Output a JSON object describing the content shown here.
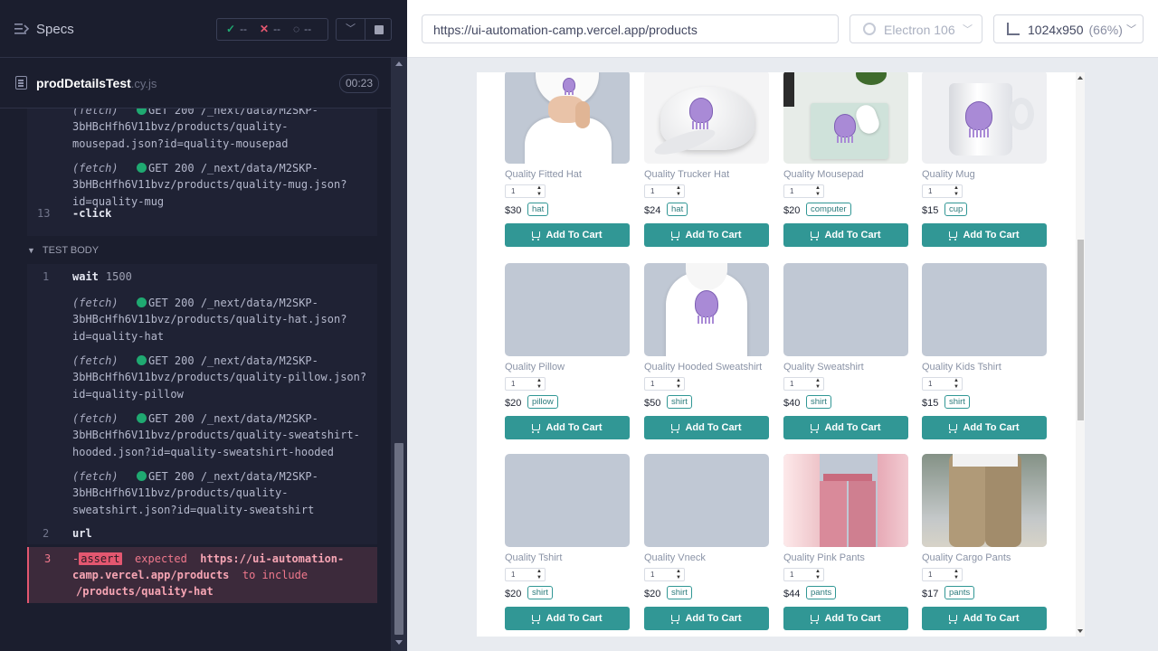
{
  "reporter": {
    "specs_label": "Specs",
    "stats": {
      "passed": "--",
      "failed": "--",
      "pending": "--"
    },
    "spec_name": "prodDetailsTest",
    "spec_ext": ".cy.js",
    "spec_time": "00:23",
    "before_commands": [
      {
        "lines": [
          "(fetch)  ",
          "GET 200 /_next/data/M2SKP-",
          "3bHBcHfh6V11bvz/products/quality-",
          "mousepad.json?id=quality-mousepad"
        ]
      },
      {
        "lines": [
          "(fetch)  ",
          "GET 200 /_next/data/M2SKP-",
          "3bHBcHfh6V11bvz/products/quality-mug.json?",
          "id=quality-mug"
        ]
      }
    ],
    "click_num": "13",
    "click_label": "-click",
    "test_body_label": "TEST BODY",
    "wait": {
      "num": "1",
      "label": "wait",
      "arg": "1500"
    },
    "body_fetches": [
      {
        "lines": [
          "(fetch)  ",
          "GET 200 /_next/data/M2SKP-",
          "3bHBcHfh6V11bvz/products/quality-hat.json?",
          "id=quality-hat"
        ]
      },
      {
        "lines": [
          "(fetch)  ",
          "GET 200 /_next/data/M2SKP-",
          "3bHBcHfh6V11bvz/products/quality-pillow.json?",
          "id=quality-pillow"
        ]
      },
      {
        "lines": [
          "(fetch)  ",
          "GET 200 /_next/data/M2SKP-",
          "3bHBcHfh6V11bvz/products/quality-sweatshirt-",
          "hooded.json?id=quality-sweatshirt-hooded"
        ]
      },
      {
        "lines": [
          "(fetch)  ",
          "GET 200 /_next/data/M2SKP-",
          "3bHBcHfh6V11bvz/products/quality-",
          "sweatshirt.json?id=quality-sweatshirt"
        ]
      }
    ],
    "url_cmd": {
      "num": "2",
      "label": "url"
    },
    "assert_cmd": {
      "num": "3",
      "dash": "-",
      "tag": "assert",
      "expected": "expected",
      "url_part1": "https://ui-automation-",
      "url_part2": "camp.vercel.app/products",
      "to_include": "to include",
      "path": "/products/quality-hat"
    }
  },
  "browser": {
    "url": "https://ui-automation-camp.vercel.app/products",
    "browser_name": "Electron 106",
    "viewport": "1024x950",
    "zoom": "(66%)"
  },
  "products": [
    {
      "name": "Quality Fitted Hat",
      "qty": "1",
      "price": "$30",
      "tag": "hat",
      "button": "Add To Cart",
      "image": "white-hat"
    },
    {
      "name": "Quality Trucker Hat",
      "qty": "1",
      "price": "$24",
      "tag": "hat",
      "button": "Add To Cart",
      "image": "trucker-hat"
    },
    {
      "name": "Quality Mousepad",
      "qty": "1",
      "price": "$20",
      "tag": "computer",
      "button": "Add To Cart",
      "image": "mousepad"
    },
    {
      "name": "Quality Mug",
      "qty": "1",
      "price": "$15",
      "tag": "cup",
      "button": "Add To Cart",
      "image": "mug"
    },
    {
      "name": "Quality Pillow",
      "qty": "1",
      "price": "$20",
      "tag": "pillow",
      "button": "Add To Cart",
      "image": "placeholder"
    },
    {
      "name": "Quality Hooded Sweatshirt",
      "qty": "1",
      "price": "$50",
      "tag": "shirt",
      "button": "Add To Cart",
      "image": "hoodie"
    },
    {
      "name": "Quality Sweatshirt",
      "qty": "1",
      "price": "$40",
      "tag": "shirt",
      "button": "Add To Cart",
      "image": "placeholder"
    },
    {
      "name": "Quality Kids Tshirt",
      "qty": "1",
      "price": "$15",
      "tag": "shirt",
      "button": "Add To Cart",
      "image": "placeholder"
    },
    {
      "name": "Quality Tshirt",
      "qty": "1",
      "price": "$20",
      "tag": "shirt",
      "button": "Add To Cart",
      "image": "placeholder"
    },
    {
      "name": "Quality Vneck",
      "qty": "1",
      "price": "$20",
      "tag": "shirt",
      "button": "Add To Cart",
      "image": "placeholder"
    },
    {
      "name": "Quality Pink Pants",
      "qty": "1",
      "price": "$44",
      "tag": "pants",
      "button": "Add To Cart",
      "image": "pink-pants"
    },
    {
      "name": "Quality Cargo Pants",
      "qty": "1",
      "price": "$17",
      "tag": "pants",
      "button": "Add To Cart",
      "image": "cargo-pants"
    }
  ],
  "colors": {
    "accent": "#319795",
    "reporter_bg": "#1b1e2e",
    "fail": "#e45770",
    "success": "#1fa971"
  }
}
